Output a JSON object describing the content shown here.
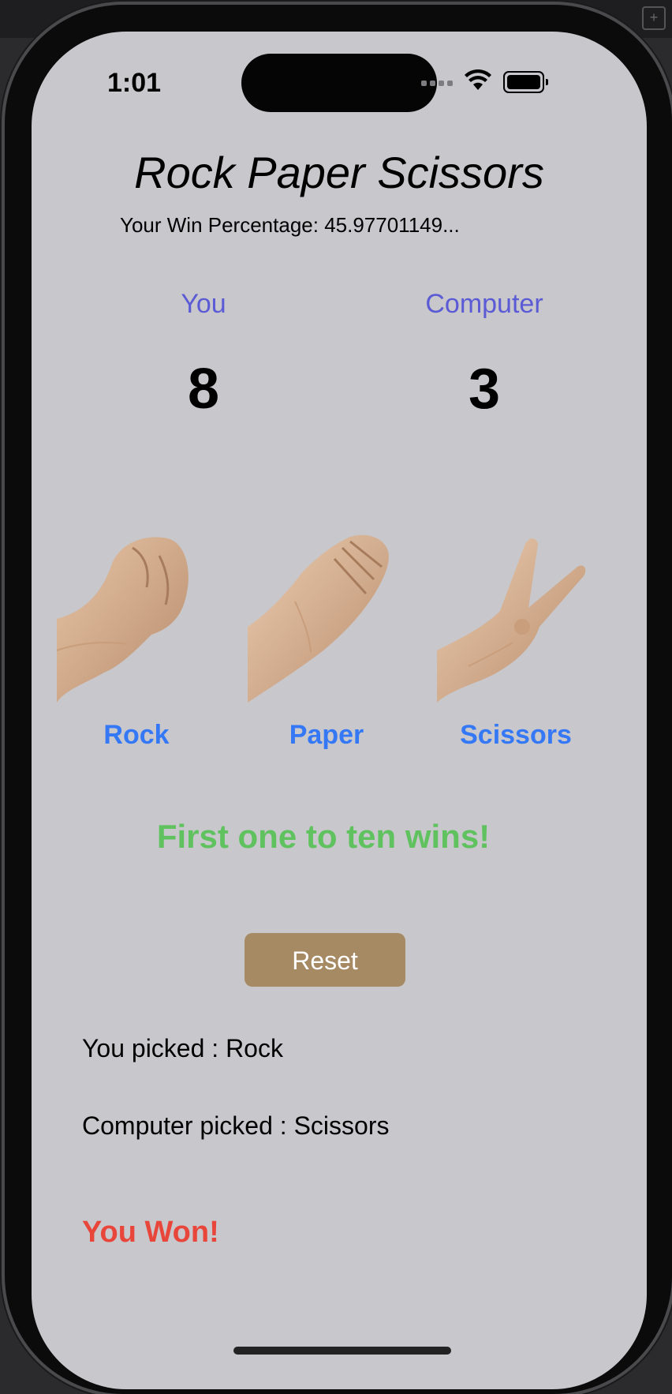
{
  "status_bar": {
    "time": "1:01"
  },
  "app": {
    "title": "Rock Paper Scissors",
    "win_percentage": "Your Win Percentage: 45.97701149..."
  },
  "scoreboard": {
    "player_label": "You",
    "computer_label": "Computer",
    "player_score": "8",
    "computer_score": "3"
  },
  "choices": [
    {
      "label": "Rock",
      "icon": "rock-hand-icon"
    },
    {
      "label": "Paper",
      "icon": "paper-hand-icon"
    },
    {
      "label": "Scissors",
      "icon": "scissors-hand-icon"
    }
  ],
  "goal_text": "First one to ten wins!",
  "reset_label": "Reset",
  "player_pick": "You picked : Rock",
  "computer_pick": "Computer picked : Scissors",
  "result_text": "You Won!",
  "colors": {
    "screen_bg": "#c8c7cc",
    "score_label": "#5b5bd6",
    "choice_label": "#3478f6",
    "goal_text": "#5fc25f",
    "reset_button": "#a58a64",
    "result_text": "#e8463a"
  }
}
